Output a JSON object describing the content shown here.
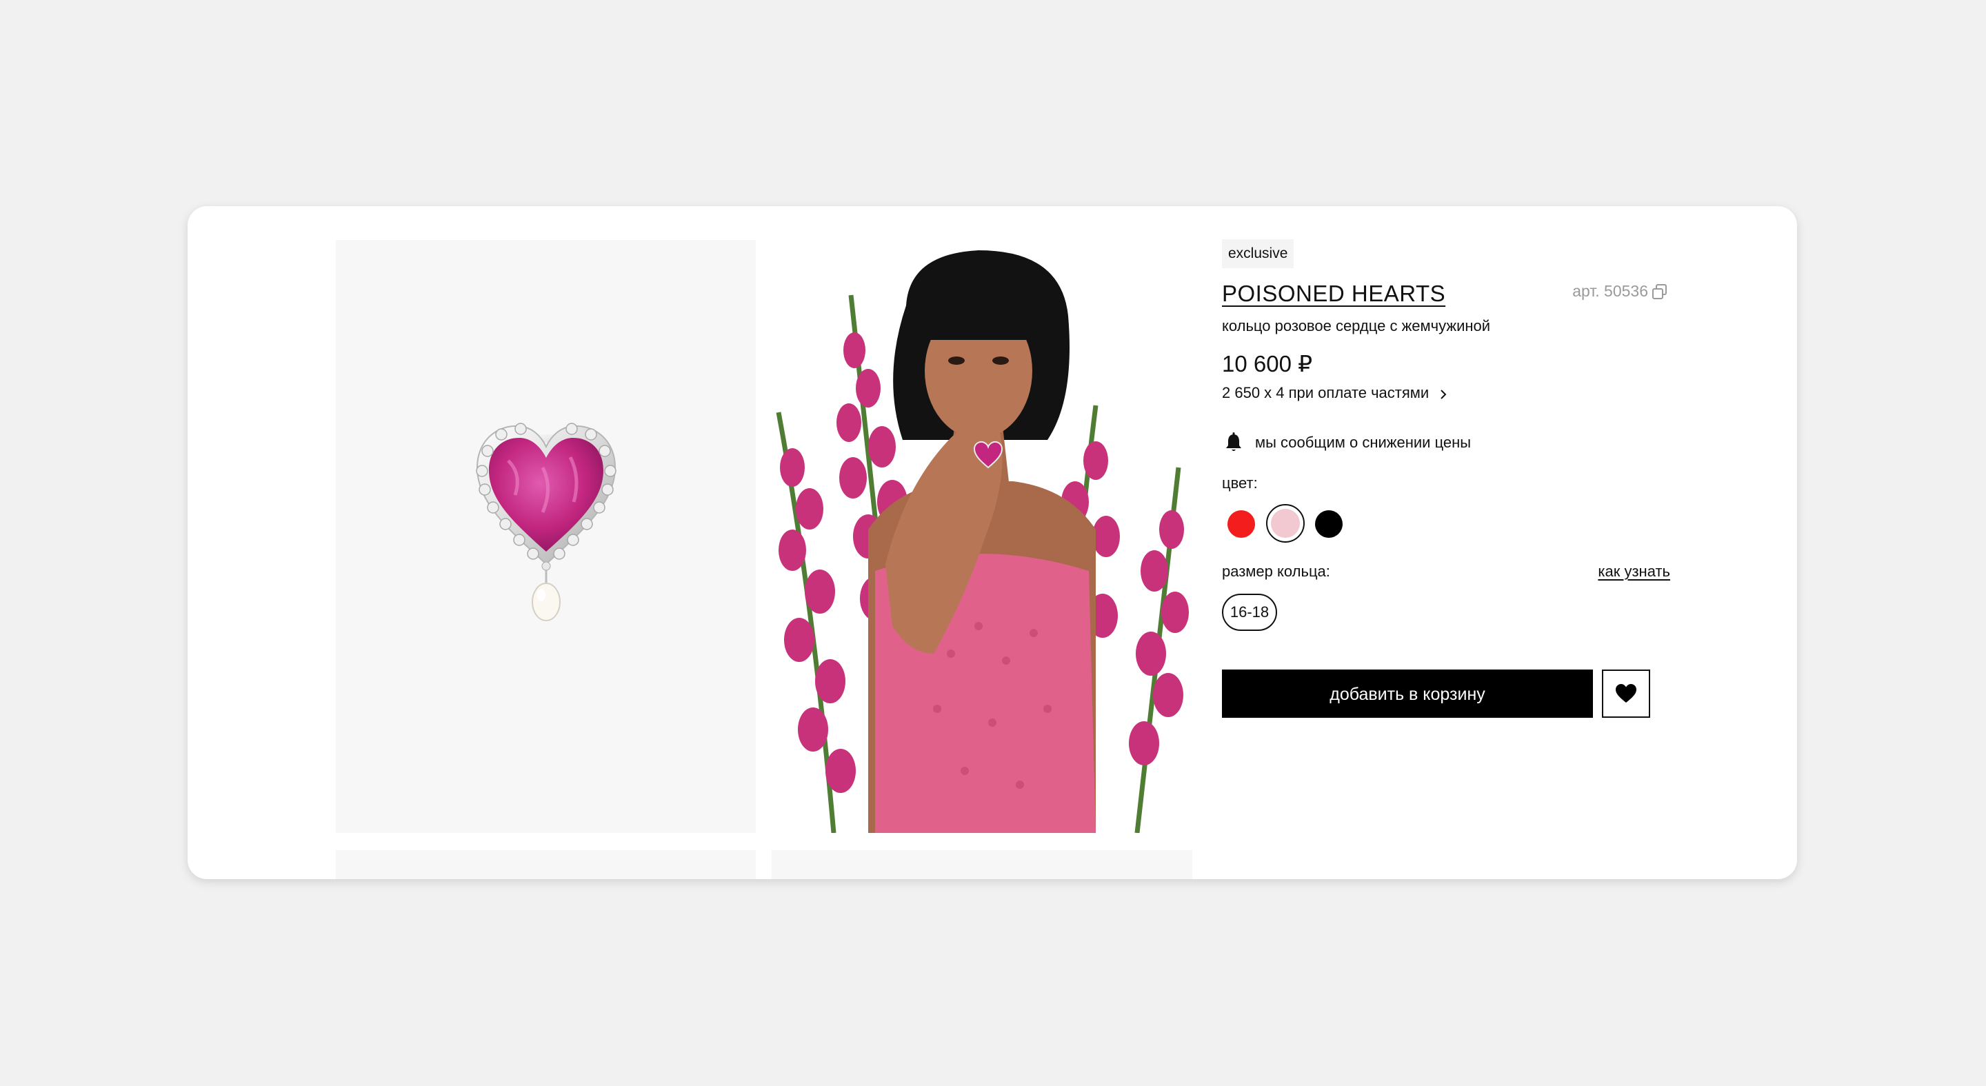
{
  "product": {
    "badge": "exclusive",
    "name": "POISONED HEARTS",
    "sku_label": "арт. 50536",
    "description": "кольцо розовое сердце с жемчужиной",
    "price": "10 600 ₽",
    "installments": "2 650 x 4 при оплате частями",
    "price_alert": "мы сообщим о снижении цены"
  },
  "colors": {
    "label": "цвет:",
    "options": [
      {
        "name": "red",
        "hex": "#f41d1d"
      },
      {
        "name": "pink",
        "hex": "#f2c9d0",
        "selected": true
      },
      {
        "name": "black",
        "hex": "#000000"
      }
    ]
  },
  "size": {
    "label": "размер кольца:",
    "guide_link": "как узнать",
    "options": [
      "16-18"
    ]
  },
  "actions": {
    "add_to_cart": "добавить в корзину"
  },
  "icons": {
    "copy": "copy-icon",
    "chevron": "chevron-right-icon",
    "bell": "bell-icon",
    "wishlist": "heart-icon"
  },
  "palette": {
    "accent": "#000000",
    "ring_enamel": "#c2267f",
    "dress": "#e0628a"
  }
}
